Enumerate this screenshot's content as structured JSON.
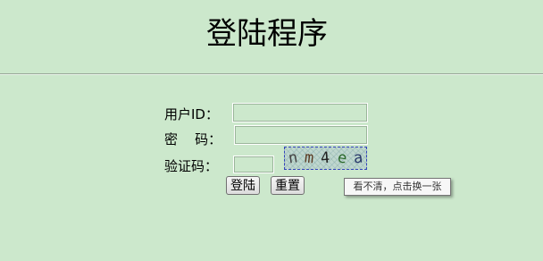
{
  "page": {
    "title": "登陆程序"
  },
  "form": {
    "user_id_label": "用户ID：",
    "password_label": "密    码：",
    "captcha_label": "验证码：",
    "user_id_value": "",
    "password_value": "",
    "captcha_value": "",
    "captcha_chars": [
      "n",
      "m",
      "4",
      "e",
      "a"
    ],
    "captcha_colors": [
      "#444444",
      "#5a3a22",
      "#222222",
      "#2c6a2c",
      "#2a3a6a"
    ]
  },
  "buttons": {
    "login_label": "登陆",
    "reset_label": "重置"
  },
  "tooltip": {
    "text": "看不清，点击换一张"
  }
}
